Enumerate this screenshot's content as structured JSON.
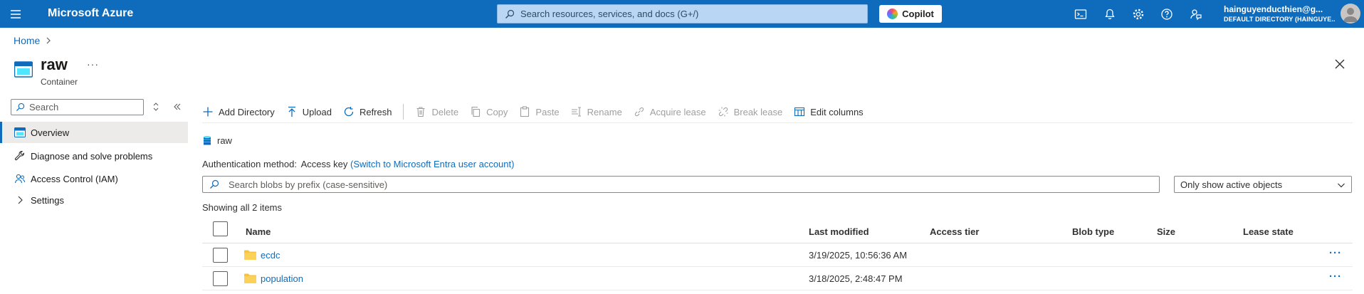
{
  "topbar": {
    "brand": "Microsoft Azure",
    "search_placeholder": "Search resources, services, and docs (G+/)",
    "copilot_label": "Copilot",
    "account_user": "hainguyenducthien@g...",
    "account_directory": "DEFAULT DIRECTORY (HAINGUYE..."
  },
  "breadcrumb": {
    "home": "Home",
    "separator": ">"
  },
  "header": {
    "title": "raw",
    "subtitle": "Container",
    "more": "···"
  },
  "nav": {
    "search_placeholder": "Search",
    "items": [
      {
        "label": "Overview",
        "icon": "container-icon",
        "active": true
      },
      {
        "label": "Diagnose and solve problems",
        "icon": "wrench-icon"
      },
      {
        "label": "Access Control (IAM)",
        "icon": "people-icon"
      },
      {
        "label": "Settings",
        "icon": "chevron-right-icon"
      }
    ]
  },
  "commands": {
    "add_directory": "Add Directory",
    "upload": "Upload",
    "refresh": "Refresh",
    "delete": "Delete",
    "copy": "Copy",
    "paste": "Paste",
    "rename": "Rename",
    "acquire_lease": "Acquire lease",
    "break_lease": "Break lease",
    "edit_columns": "Edit columns"
  },
  "location": "raw",
  "auth": {
    "label": "Authentication method:",
    "value": "Access key",
    "switch_link": "(Switch to Microsoft Entra user account)"
  },
  "blob_search_placeholder": "Search blobs by prefix (case-sensitive)",
  "filter": {
    "selected": "Only show active objects"
  },
  "count_text": "Showing all 2 items",
  "table": {
    "columns": [
      "Name",
      "Last modified",
      "Access tier",
      "Blob type",
      "Size",
      "Lease state"
    ],
    "rows": [
      {
        "name": "ecdc",
        "last_modified": "3/19/2025, 10:56:36 AM",
        "more": "···"
      },
      {
        "name": "population",
        "last_modified": "3/18/2025, 2:48:47 PM",
        "more": "···"
      }
    ]
  },
  "colors": {
    "accent": "#0f6cbd",
    "folder": "#f8c23a"
  }
}
